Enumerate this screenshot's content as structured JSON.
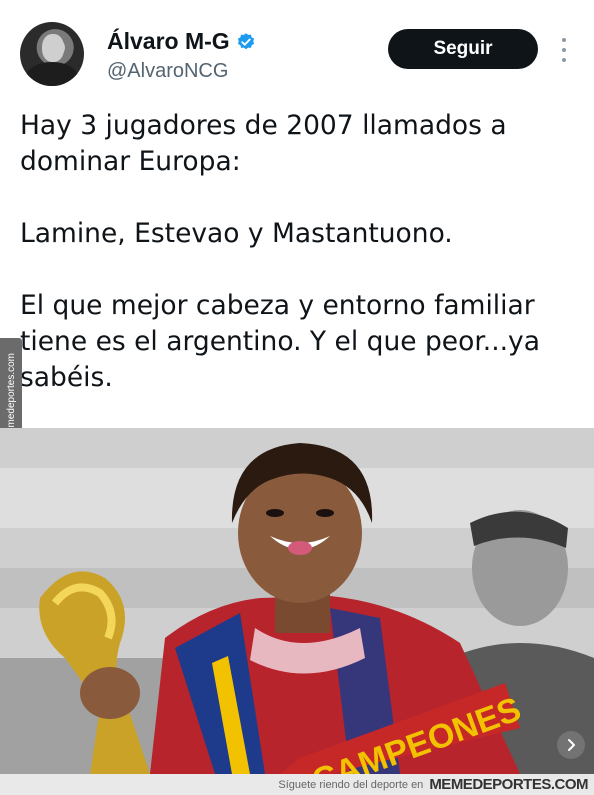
{
  "author": {
    "name": "Álvaro M-G",
    "handle": "@AlvaroNCG",
    "verified": true,
    "verified_color": "#1d9bf0"
  },
  "actions": {
    "follow_label": "Seguir",
    "more_icon": "more-vertical-icon"
  },
  "tweet": {
    "paragraphs": [
      "Hay 3 jugadores de 2007 llamados a dominar Europa:",
      "Lamine, Estevao y Mastantuono.",
      "El que mejor cabeza y entorno familiar tiene es el argentino. Y el que peor...ya sabéis."
    ]
  },
  "media": {
    "jersey_text": "CAMPEONES",
    "carousel_icon": "chevron-right-icon"
  },
  "watermark": {
    "side_text": "Memedeportes.com",
    "footer_tagline": "Síguete riendo del deporte en",
    "footer_brand": "MEMEDEPORTES.COM"
  },
  "colors": {
    "follow_bg": "#0f1419",
    "text": "#0f1419",
    "muted": "#536471"
  }
}
